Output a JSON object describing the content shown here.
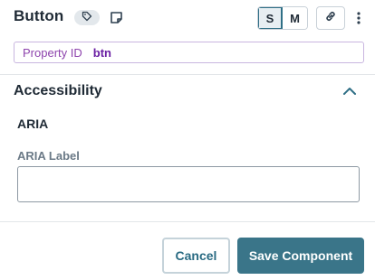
{
  "header": {
    "title": "Button",
    "tag_icon": "tag-icon",
    "note_icon": "sticky-note-icon",
    "size_options": [
      "S",
      "M"
    ],
    "active_size": "S",
    "link_icon": "link-icon",
    "more_icon": "more-vertical-icon"
  },
  "property": {
    "label": "Property ID",
    "value": "btn"
  },
  "section": {
    "title": "Accessibility",
    "collapse_icon": "chevron-up-icon",
    "subheading": "ARIA",
    "aria_label": {
      "label": "ARIA Label",
      "value": "",
      "placeholder": ""
    }
  },
  "footer": {
    "cancel_label": "Cancel",
    "save_label": "Save Component"
  },
  "colors": {
    "accent": "#3a7589",
    "property_purple": "#8e44ad",
    "text_dark": "#1f2a35",
    "border_light": "#c9d1d8"
  }
}
